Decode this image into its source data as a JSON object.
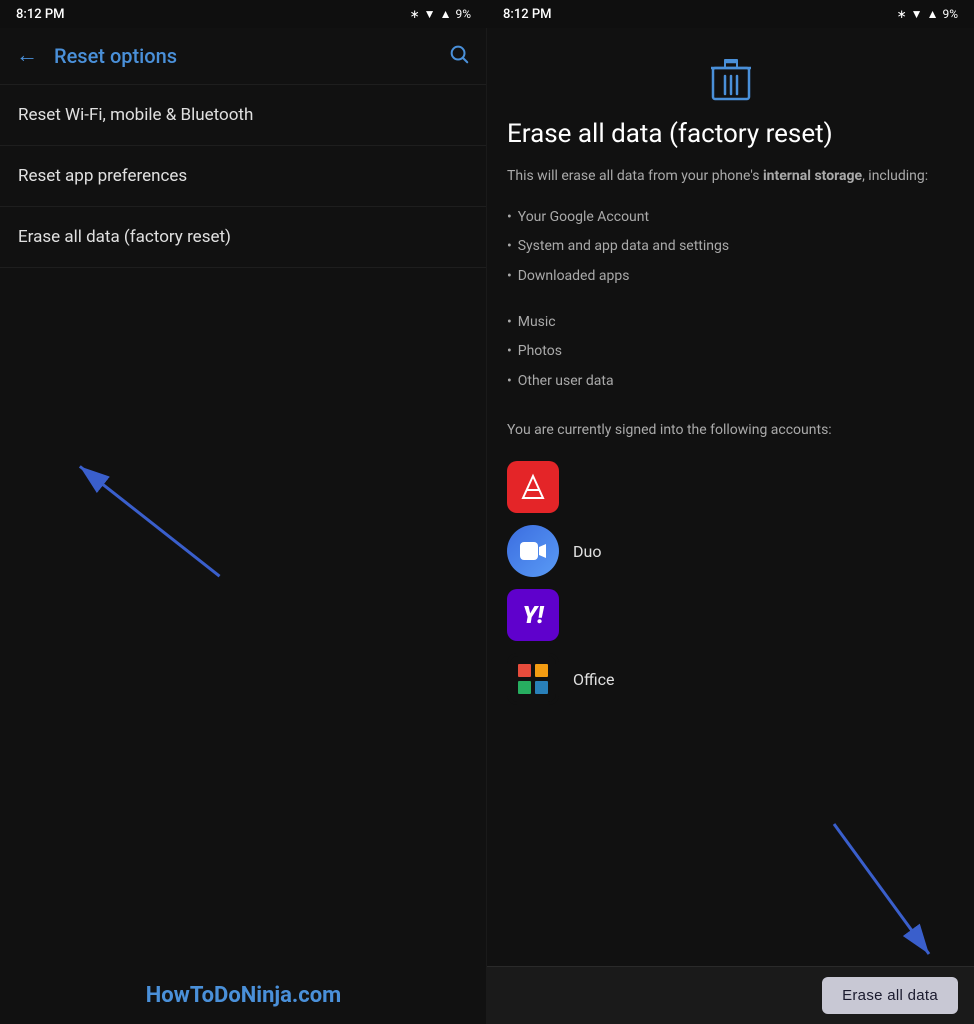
{
  "app": {
    "name": "Reset Options"
  },
  "left_panel": {
    "status_bar": {
      "time": "8:12 PM",
      "battery": "9%"
    },
    "toolbar": {
      "back_label": "←",
      "title": "Reset options",
      "search_label": "🔍"
    },
    "menu_items": [
      {
        "id": "wifi",
        "label": "Reset Wi-Fi, mobile & Bluetooth"
      },
      {
        "id": "app-prefs",
        "label": "Reset app preferences"
      },
      {
        "id": "factory",
        "label": "Erase all data (factory reset)"
      }
    ],
    "watermark": "HowToDoNinja.com"
  },
  "right_panel": {
    "status_bar": {
      "time": "8:12 PM",
      "battery": "9%"
    },
    "trash_icon": "🗑",
    "title": "Erase all data (factory reset)",
    "description_prefix": "This will erase all data from your phone's ",
    "description_bold": "internal storage",
    "description_suffix": ", including:",
    "items_1": [
      "Your Google Account",
      "System and app data and settings",
      "Downloaded apps"
    ],
    "items_2": [
      "Music",
      "Photos",
      "Other user data"
    ],
    "signed_in_text": "You are currently signed into the following accounts:",
    "accounts": [
      {
        "id": "adobe",
        "type": "adobe",
        "label": ""
      },
      {
        "id": "duo",
        "type": "duo",
        "label": "Duo"
      },
      {
        "id": "yahoo",
        "type": "yahoo",
        "label": ""
      },
      {
        "id": "office",
        "type": "office",
        "label": "Office"
      }
    ],
    "erase_button_label": "Erase all data"
  }
}
